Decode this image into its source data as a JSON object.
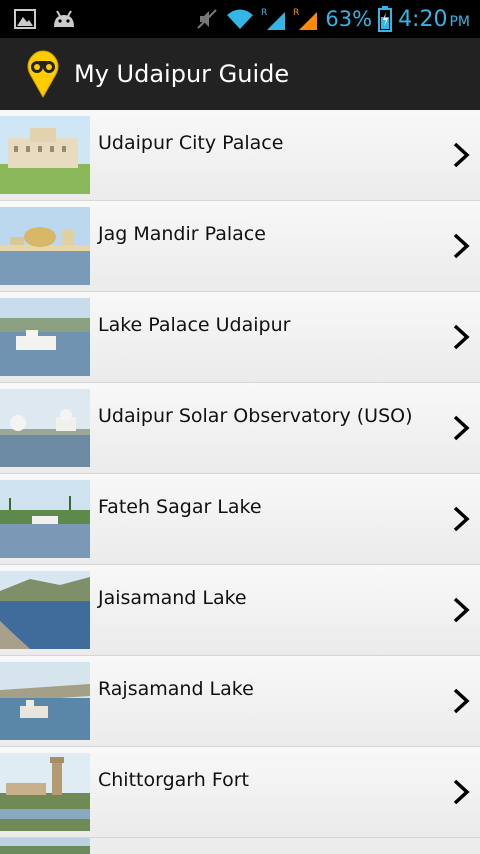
{
  "status_bar": {
    "battery_percent": "63%",
    "time": "4:20",
    "ampm": "PM",
    "icons": [
      "image-icon",
      "android-icon",
      "mute-icon",
      "wifi-icon",
      "signal-r-icon",
      "signal-r2-icon",
      "battery-icon"
    ]
  },
  "app_bar": {
    "title": "My Udaipur Guide",
    "icon": "map-pin-binoculars-icon"
  },
  "places": [
    {
      "label": "Udaipur City Palace"
    },
    {
      "label": "Jag Mandir Palace"
    },
    {
      "label": "Lake Palace Udaipur"
    },
    {
      "label": "Udaipur Solar Observatory (USO)"
    },
    {
      "label": "Fateh Sagar Lake"
    },
    {
      "label": "Jaisamand Lake"
    },
    {
      "label": "Rajsamand Lake"
    },
    {
      "label": "Chittorgarh Fort"
    }
  ],
  "colors": {
    "status_accent": "#33b5e5",
    "action_bar_bg": "#222222",
    "pin_yellow": "#ffcc00"
  }
}
